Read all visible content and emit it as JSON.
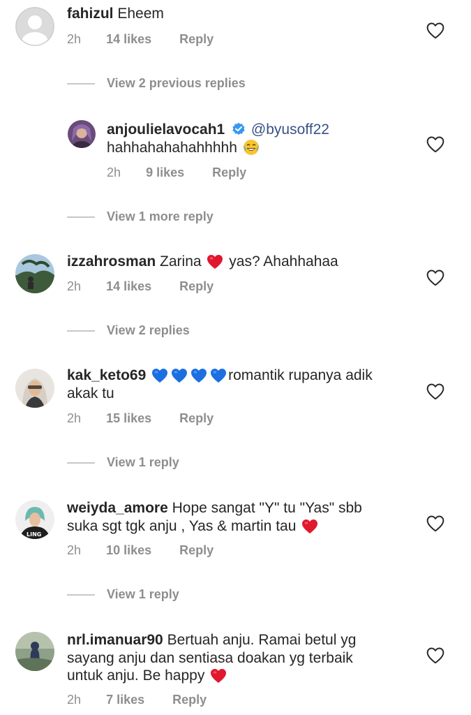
{
  "comments": [
    {
      "username": "fahizul",
      "text": "Eheem",
      "time": "2h",
      "likes": "14 likes",
      "reply": "Reply"
    },
    {
      "username": "anjoulielavocah1",
      "mention": "@byusoff22",
      "text": "hahhahahahahhhhh",
      "time": "2h",
      "likes": "9 likes",
      "reply": "Reply"
    },
    {
      "username": "izzahrosman",
      "text_a": "Zarina",
      "text_b": "yas? Ahahhahaa",
      "time": "2h",
      "likes": "14 likes",
      "reply": "Reply"
    },
    {
      "username": "kak_keto69",
      "text_a": "romantik rupanya adik",
      "text_b": "akak tu",
      "time": "2h",
      "likes": "15 likes",
      "reply": "Reply"
    },
    {
      "username": "weiyda_amore",
      "text_a": "Hope sangat \"Y\" tu \"Yas\" sbb",
      "text_b": "suka sgt tgk anju , Yas & martin tau",
      "time": "2h",
      "likes": "10 likes",
      "reply": "Reply"
    },
    {
      "username": "nrl.imanuar90",
      "text_a": "Bertuah anju. Ramai betul yg",
      "text_b": "sayang anju dan sentiasa doakan yg terbaik",
      "text_c": "untuk anju. Be happy",
      "time": "2h",
      "likes": "7 likes",
      "reply": "Reply"
    }
  ],
  "view_links": {
    "previous": "View 2 previous replies",
    "more": "View 1 more reply",
    "replies2": "View 2 replies",
    "reply1a": "View 1 reply",
    "reply1b": "View 1 reply"
  },
  "icons": {
    "heart_outline": "heart-outline-icon",
    "heart_emoji": "red-heart-emoji",
    "blue_heart": "blue-heart-emoji",
    "laugh_emoji": "tears-of-joy-emoji",
    "verified": "verified-badge-icon"
  },
  "colors": {
    "text": "#262626",
    "meta": "#8e8e8e",
    "mention": "#385185",
    "verified": "#3897f0"
  }
}
